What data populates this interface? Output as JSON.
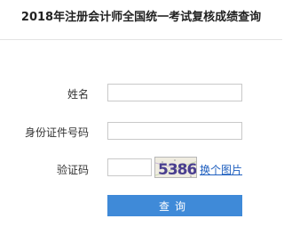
{
  "page_title": "2018年注册会计师全国统一考试复核成绩查询",
  "form": {
    "name_label": "姓名",
    "name_value": "",
    "id_label": "身份证件号码",
    "id_value": "",
    "captcha_label": "验证码",
    "captcha_value": "",
    "captcha_text": "5386",
    "change_image_label": "换个图片",
    "submit_label": "查询"
  },
  "colors": {
    "button_bg": "#3f8ad8",
    "link": "#1f5fbf"
  }
}
